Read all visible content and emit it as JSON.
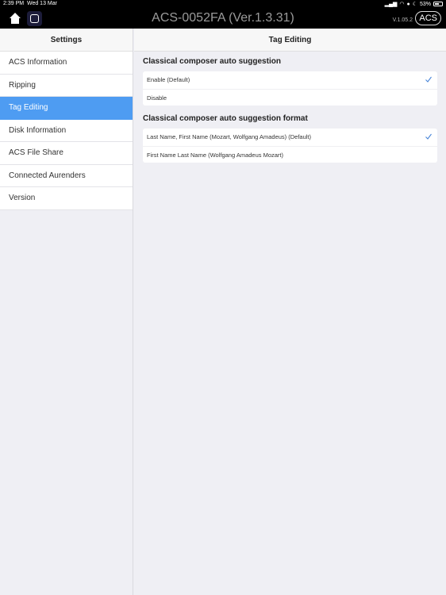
{
  "status_bar": {
    "time": "2:39 PM",
    "date": "Wed 13 Mar",
    "battery": "53%",
    "battery_level": 0.53
  },
  "header": {
    "title": "ACS-0052FA (Ver.1.3.31)",
    "app_version": "V.1.05.2",
    "acs_button": "ACS"
  },
  "sidebar": {
    "title": "Settings",
    "items": [
      {
        "label": "ACS Information",
        "active": false
      },
      {
        "label": "Ripping",
        "active": false
      },
      {
        "label": "Tag Editing",
        "active": true
      },
      {
        "label": "Disk Information",
        "active": false
      },
      {
        "label": "ACS File Share",
        "active": false
      },
      {
        "label": "Connected Aurenders",
        "active": false
      },
      {
        "label": "Version",
        "active": false
      }
    ]
  },
  "main": {
    "title": "Tag Editing",
    "sections": [
      {
        "title": "Classical composer auto suggestion",
        "options": [
          {
            "label": "Enable (Default)",
            "selected": true
          },
          {
            "label": "Disable",
            "selected": false
          }
        ]
      },
      {
        "title": "Classical composer auto suggestion format",
        "options": [
          {
            "label": "Last Name, First Name (Mozart, Wolfgang Amadeus) (Default)",
            "selected": true
          },
          {
            "label": "First Name Last Name (Wolfgang Amadeus Mozart)",
            "selected": false
          }
        ]
      }
    ]
  },
  "colors": {
    "accent": "#4e9cf2",
    "check": "#4a86d8"
  }
}
